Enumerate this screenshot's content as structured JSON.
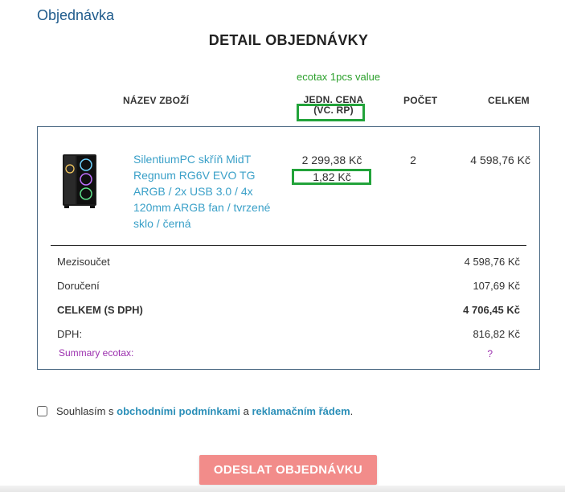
{
  "section_title": "Objednávka",
  "main_title": "DETAIL OBJEDNÁVKY",
  "annotation": "ecotax 1pcs  value",
  "columns": {
    "name": "NÁZEV ZBOŽÍ",
    "unit_price": "JEDN. CENA (VČ. RP)",
    "quantity": "POČET",
    "total": "CELKEM"
  },
  "item": {
    "name": "SilentiumPC skříň MidT Regnum RG6V EVO TG ARGB / 2x USB 3.0 / 4x 120mm ARGB fan / tvrzené sklo / černá",
    "unit_price": "2 299,38 Kč",
    "ecotax_unit": "1,82 Kč",
    "quantity": "2",
    "total": "4 598,76 Kč"
  },
  "summary": {
    "subtotal_label": "Mezisoučet",
    "subtotal_value": "4 598,76 Kč",
    "delivery_label": "Doručení",
    "delivery_value": "107,69 Kč",
    "total_label": "CELKEM (S DPH)",
    "total_value": "4 706,45 Kč",
    "vat_label": "DPH:",
    "vat_value": "816,82 Kč",
    "ecotax_label": "Summary ecotax:",
    "ecotax_value": "?"
  },
  "consent": {
    "prefix": "Souhlasím s",
    "terms_link": "obchodními podmínkami",
    "middle": "a",
    "complaint_link": "reklamačním řádem",
    "suffix": "."
  },
  "submit_label": "ODESLAT OBJEDNÁVKU",
  "colors": {
    "accent_blue": "#1f5b8c",
    "link": "#2b8fb8",
    "highlight_green": "#22a33a",
    "ecotax_purple": "#9b2fae",
    "submit_button": "#f28c8a"
  }
}
